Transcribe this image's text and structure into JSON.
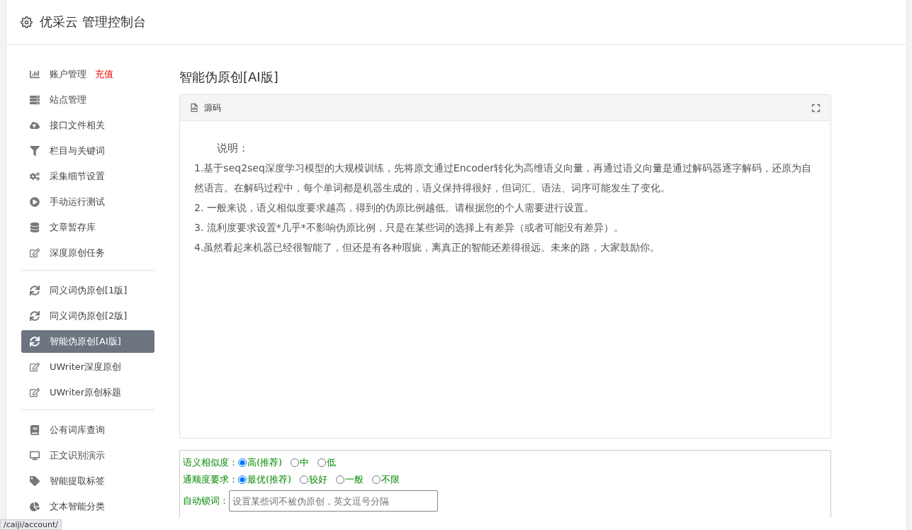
{
  "header": {
    "title": "优采云 管理控制台"
  },
  "sidebar": {
    "groups": [
      {
        "items": [
          {
            "label": "账户管理",
            "badge": "充值",
            "selected": false
          },
          {
            "label": "站点管理",
            "selected": false
          },
          {
            "label": "接口文件相关",
            "selected": false
          },
          {
            "label": "栏目与关键词",
            "selected": false
          },
          {
            "label": "采集细节设置",
            "selected": false
          },
          {
            "label": "手动运行测试",
            "selected": false
          },
          {
            "label": "文章暂存库",
            "selected": false
          },
          {
            "label": "深度原创任务",
            "selected": false
          }
        ]
      },
      {
        "items": [
          {
            "label": "同义词伪原创[1版]",
            "selected": false
          },
          {
            "label": "同义词伪原创[2版]",
            "selected": false
          },
          {
            "label": "智能伪原创[AI版]",
            "selected": true
          },
          {
            "label": "UWriter深度原创",
            "selected": false
          },
          {
            "label": "UWriter原创标题",
            "selected": false
          }
        ]
      },
      {
        "items": [
          {
            "label": "公有词库查询",
            "selected": false
          },
          {
            "label": "正文识别演示",
            "selected": false
          },
          {
            "label": "智能提取标签",
            "selected": false
          },
          {
            "label": "文本智能分类",
            "selected": false
          }
        ]
      }
    ]
  },
  "page_title": "智能伪原创[AI版]",
  "source_panel": {
    "title": "源码",
    "heading": "说明：",
    "lines": [
      "1.基于seq2seq深度学习模型的大规模训练，先将原文通过Encoder转化为高维语义向量，再通过语义向量是通过解码器逐字解码，还原为自然语言。在解码过程中，每个单词都是机器生成的，语义保持得很好，但词汇、语法、词序可能发生了变化。",
      "2. 一般来说，语义相似度要求越高，得到的伪原比例越低。请根据您的个人需要进行设置。",
      "3. 流利度要求设置*几乎*不影响伪原比例，只是在某些词的选择上有差异（或者可能没有差异）。",
      "4.虽然看起来机器已经很智能了，但还是有各种瑕疵，离真正的智能还差得很远。未来的路，大家鼓励你。"
    ]
  },
  "options": [
    {
      "label": "语义相似度：",
      "choices": [
        {
          "label": "高(推荐)",
          "selected": true
        },
        {
          "label": "中",
          "selected": false
        },
        {
          "label": "低",
          "selected": false
        }
      ]
    },
    {
      "label": "通顺度要求：",
      "choices": [
        {
          "label": "最优(推荐)",
          "selected": true
        },
        {
          "label": "较好",
          "selected": false
        },
        {
          "label": "一般",
          "selected": false
        },
        {
          "label": "不限",
          "selected": false
        }
      ]
    }
  ],
  "lock_words": {
    "label": "自动锁词：",
    "placeholder": "设置某些词不被伪原创，英文逗号分隔"
  },
  "status_url": "/caiji/account/"
}
